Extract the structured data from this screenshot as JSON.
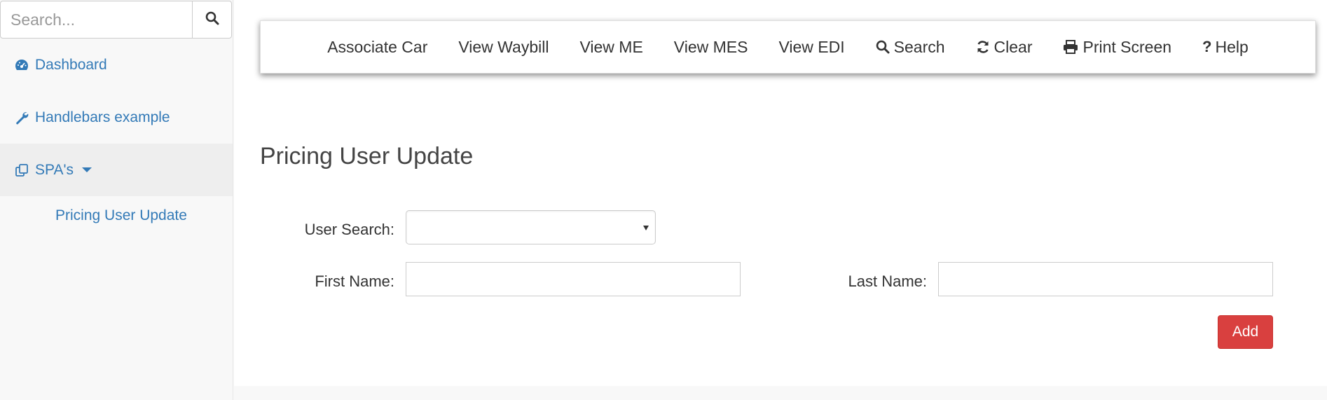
{
  "sidebar": {
    "search": {
      "placeholder": "Search...",
      "icon": "search-icon"
    },
    "items": [
      {
        "label": "Dashboard",
        "icon": "dashboard-icon"
      },
      {
        "label": "Handlebars example",
        "icon": "wrench-icon"
      },
      {
        "label": "SPA's",
        "icon": "clone-icon",
        "expanded": true
      }
    ],
    "subitems": [
      {
        "label": "Pricing User Update"
      }
    ]
  },
  "toolbar": {
    "items": [
      {
        "label": "Associate Car"
      },
      {
        "label": "View Waybill"
      },
      {
        "label": "View ME"
      },
      {
        "label": "View MES"
      },
      {
        "label": "View EDI"
      },
      {
        "label": "Search",
        "icon": "search-icon"
      },
      {
        "label": "Clear",
        "icon": "refresh-icon"
      },
      {
        "label": "Print Screen",
        "icon": "print-icon"
      },
      {
        "label": "Help",
        "icon": "question-icon"
      }
    ]
  },
  "main": {
    "title": "Pricing User Update",
    "form": {
      "user_search_label": "User Search:",
      "user_search_value": "",
      "first_name_label": "First Name:",
      "first_name_value": "",
      "last_name_label": "Last Name:",
      "last_name_value": "",
      "add_label": "Add"
    }
  },
  "colors": {
    "link": "#337ab7",
    "danger": "#d9403f",
    "sidebar_bg": "#f8f8f8",
    "active_bg": "#eeeeee"
  }
}
